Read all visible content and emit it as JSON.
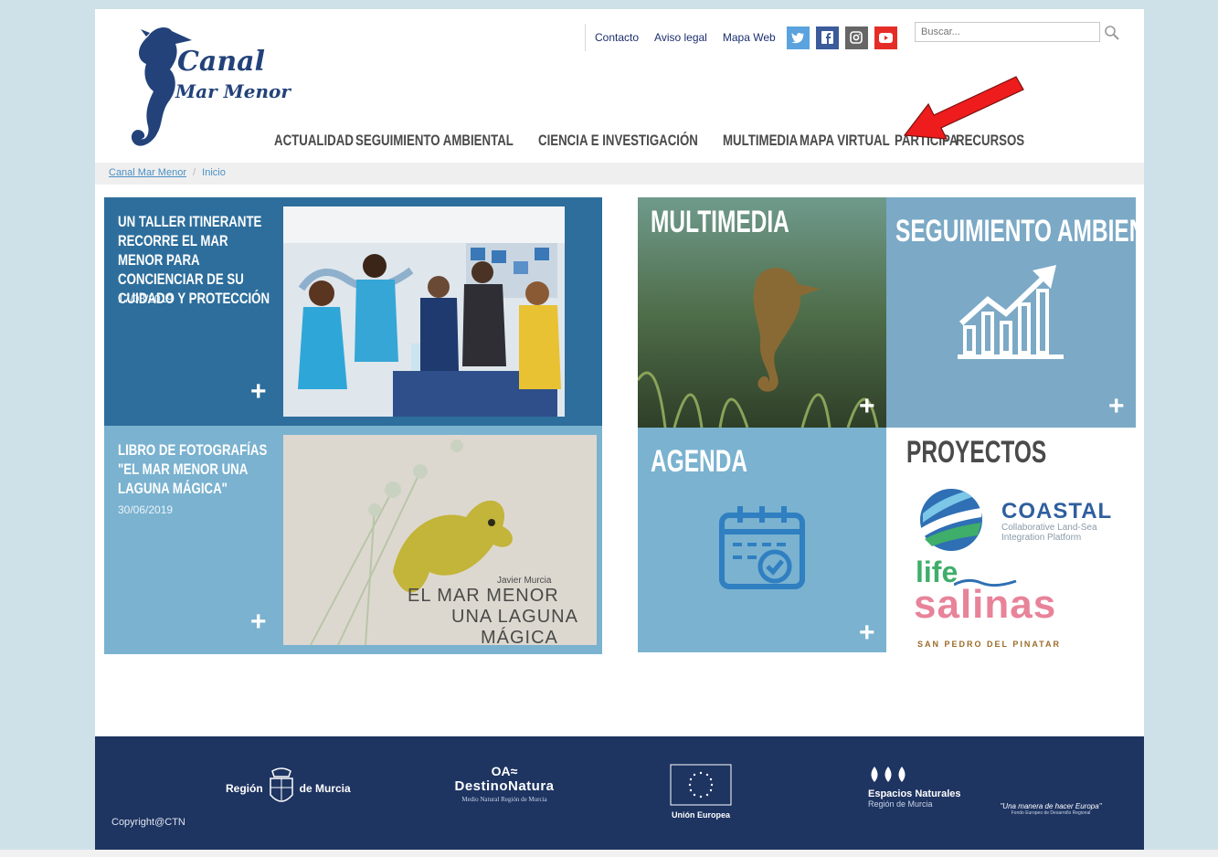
{
  "logo": {
    "line1": "Canal",
    "line2": "Mar Menor"
  },
  "topbar": {
    "links": [
      "Contacto",
      "Aviso legal",
      "Mapa Web"
    ],
    "search_placeholder": "Buscar..."
  },
  "nav": [
    "ACTUALIDAD",
    "SEGUIMIENTO AMBIENTAL",
    "CIENCIA E INVESTIGACIÓN",
    "MULTIMEDIA",
    "MAPA VIRTUAL",
    "PARTICIPA",
    "RECURSOS"
  ],
  "breadcrumb": {
    "home": "Canal Mar Menor",
    "separator": "/",
    "current": "Inicio"
  },
  "news": [
    {
      "title": "UN TALLER ITINERANTE RECORRE EL MAR MENOR PARA CONCIENCIAR DE SU CUIDADO Y PROTECCIÓN",
      "date": "17/08/2019",
      "more": "+"
    },
    {
      "title": "LIBRO DE FOTOGRAFÍAS \"EL MAR MENOR UNA LAGUNA MÁGICA\"",
      "date": "30/06/2019",
      "more": "+",
      "cover": {
        "author": "Javier Murcia",
        "line1": "EL MAR MENOR",
        "line2": "UNA LAGUNA",
        "line3": "MÁGICA"
      }
    }
  ],
  "categories": {
    "multimedia": "MULTIMEDIA",
    "seguimiento": "SEGUIMIENTO AMBIENTAL",
    "agenda": "AGENDA",
    "proyectos": "PROYECTOS",
    "more": "+"
  },
  "projects": {
    "coastal": {
      "name": "COASTAL",
      "sub1": "Collaborative Land-Sea",
      "sub2": "Integration Platform"
    },
    "salinas": {
      "life": "life",
      "name": "salinas",
      "sub": "SAN PEDRO DEL PINATAR"
    }
  },
  "footer": {
    "region_left": "Región",
    "region_right": "de Murcia",
    "oa_mark": "OA≈",
    "destino": "DestinoNatura",
    "destino_sub": "Medio Natural Región de Murcia",
    "eu": "Unión Europea",
    "espacios": "Espacios Naturales",
    "espacios_sub": "Región de Murcia",
    "feder": "\"Una manera de hacer Europa\"",
    "feder_sub": "Fondo Europeo de Desarrollo Regional",
    "copyright": "Copyright@CTN"
  },
  "colors": {
    "accent_dark": "#2d6e9c",
    "accent_light": "#7ab2d0",
    "footer": "#1e3461",
    "twitter": "#5aa3de",
    "facebook": "#3b5b9a",
    "instagram": "#666666",
    "youtube": "#e52d27",
    "arrow": "#ee1c1c"
  }
}
